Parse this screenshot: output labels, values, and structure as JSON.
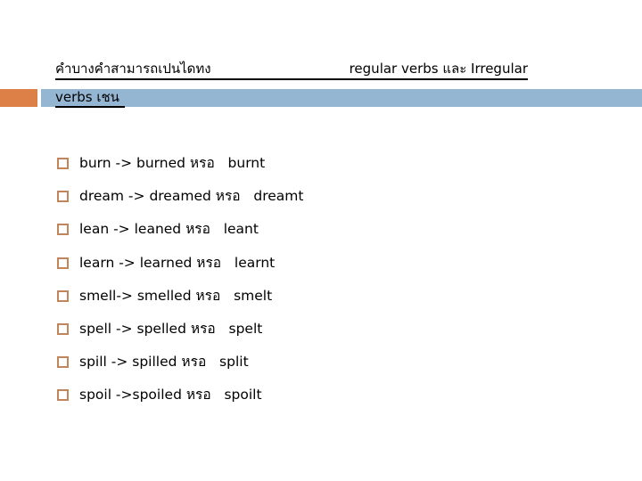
{
  "slide": {
    "title_part1": "คำบางคำสามารถเปนไดทง",
    "title_part2": "regular verbs และ Irregular",
    "title_line2": "verbs เชน",
    "accent_colors": {
      "orange": "#dd8047",
      "blue": "#94b6d2",
      "bullet": "#c0855a"
    }
  },
  "items": [
    {
      "text": "burn -> burned หรอ   burnt"
    },
    {
      "text": "dream -> dreamed หรอ   dreamt"
    },
    {
      "text": "lean -> leaned หรอ   leant"
    },
    {
      "text": "learn -> learned หรอ   learnt"
    },
    {
      "text": "smell-> smelled หรอ   smelt"
    },
    {
      "text": "spell -> spelled หรอ   spelt"
    },
    {
      "text": "spill -> spilled หรอ   split"
    },
    {
      "text": "spoil ->spoiled หรอ   spoilt"
    }
  ]
}
